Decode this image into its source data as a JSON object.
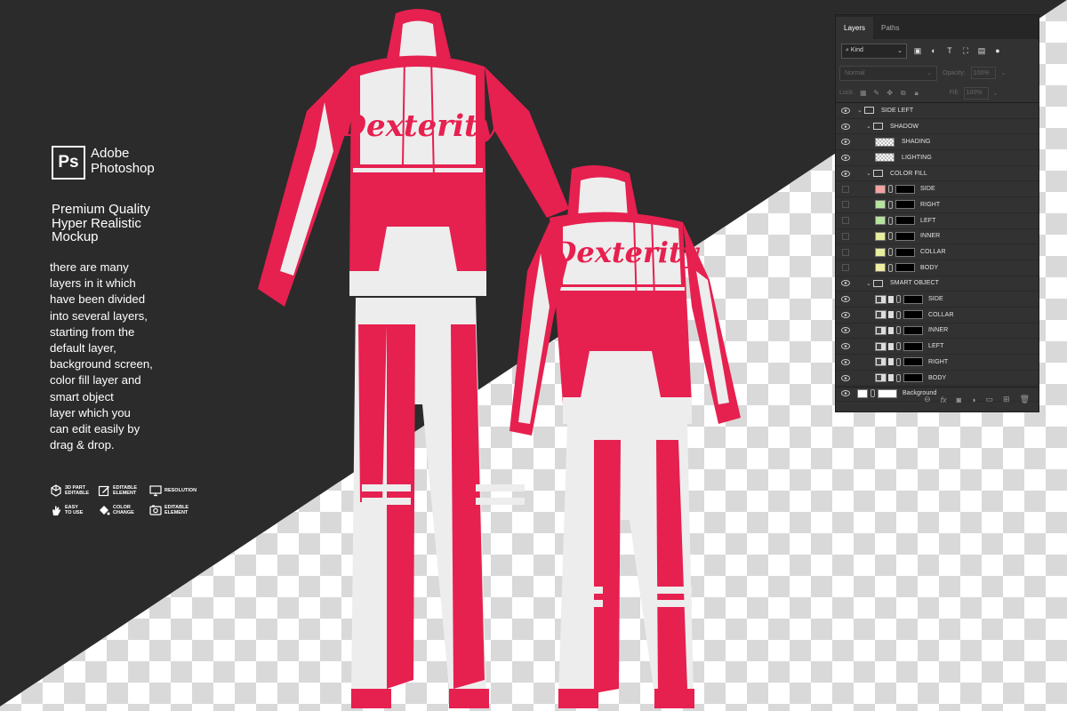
{
  "logo": {
    "box": "Ps",
    "line1": "Adobe",
    "line2": "Photoshop"
  },
  "promo": {
    "title_lines": [
      "Premium Quality",
      "Hyper Realistic",
      "Mockup"
    ],
    "body_lines": [
      "there are many",
      "layers in it which",
      "have been divided",
      "into several layers,",
      "starting from the",
      "default layer,",
      "background screen,",
      "color fill layer and",
      "smart object",
      "layer which you",
      "can edit easily by",
      "drag & drop."
    ]
  },
  "features": [
    {
      "icon": "3d-cube-icon",
      "label1": "3D PART",
      "label2": "EDITABLE"
    },
    {
      "icon": "edit-icon",
      "label1": "EDITABLE",
      "label2": "ELEMENT"
    },
    {
      "icon": "monitor-icon",
      "label1": "RESOLUTION",
      "label2": ""
    },
    {
      "icon": "hand-icon",
      "label1": "EASY",
      "label2": "TO USE"
    },
    {
      "icon": "paint-bucket-icon",
      "label1": "COLOR",
      "label2": "CHANGE"
    },
    {
      "icon": "image-icon",
      "label1": "EDITABLE",
      "label2": "ELEMENT"
    }
  ],
  "garment": {
    "brand": "Dexterity",
    "accent": "#e6204f",
    "base": "#ededed"
  },
  "panel": {
    "tabs": [
      "Layers",
      "Paths"
    ],
    "kind_label": "Kind",
    "blend_mode": "Normal",
    "opacity_label": "Opacity:",
    "opacity_value": "100%",
    "lock_label": "Lock:",
    "fill_label": "Fill:",
    "fill_value": "100%",
    "layers": [
      {
        "name": "SIDE LEFT",
        "type": "group",
        "indent": 0,
        "visible": true
      },
      {
        "name": "SHADOW",
        "type": "group",
        "indent": 1,
        "visible": true
      },
      {
        "name": "SHADING",
        "type": "pixel",
        "indent": 2,
        "visible": true
      },
      {
        "name": "LIGHTING",
        "type": "pixel",
        "indent": 2,
        "visible": true
      },
      {
        "name": "COLOR FILL",
        "type": "group",
        "indent": 1,
        "visible": true
      },
      {
        "name": "SIDE",
        "type": "fill",
        "indent": 2,
        "visible": false,
        "color": "#f2a3a3"
      },
      {
        "name": "RIGHT",
        "type": "fill",
        "indent": 2,
        "visible": false,
        "color": "#b6e3a0"
      },
      {
        "name": "LEFT",
        "type": "fill",
        "indent": 2,
        "visible": false,
        "color": "#b6e3a0"
      },
      {
        "name": "INNER",
        "type": "fill",
        "indent": 2,
        "visible": false,
        "color": "#e7ee9c"
      },
      {
        "name": "COLLAR",
        "type": "fill",
        "indent": 2,
        "visible": false,
        "color": "#e7ee9c"
      },
      {
        "name": "BODY",
        "type": "fill",
        "indent": 2,
        "visible": false,
        "color": "#eef0a0"
      },
      {
        "name": "SMART OBJECT",
        "type": "group",
        "indent": 1,
        "visible": true
      },
      {
        "name": "SIDE",
        "type": "smart",
        "indent": 2,
        "visible": true
      },
      {
        "name": "COLLAR",
        "type": "smart",
        "indent": 2,
        "visible": true
      },
      {
        "name": "INNER",
        "type": "smart",
        "indent": 2,
        "visible": true
      },
      {
        "name": "LEFT",
        "type": "smart",
        "indent": 2,
        "visible": true
      },
      {
        "name": "RIGHT",
        "type": "smart",
        "indent": 2,
        "visible": true
      },
      {
        "name": "BODY",
        "type": "smart",
        "indent": 2,
        "visible": true
      },
      {
        "name": "Background",
        "type": "background",
        "indent": 0,
        "visible": true
      }
    ],
    "footer_icons": [
      "link-icon",
      "fx-icon",
      "mask-icon",
      "adjustment-icon",
      "folder-icon",
      "new-layer-icon",
      "trash-icon"
    ]
  }
}
